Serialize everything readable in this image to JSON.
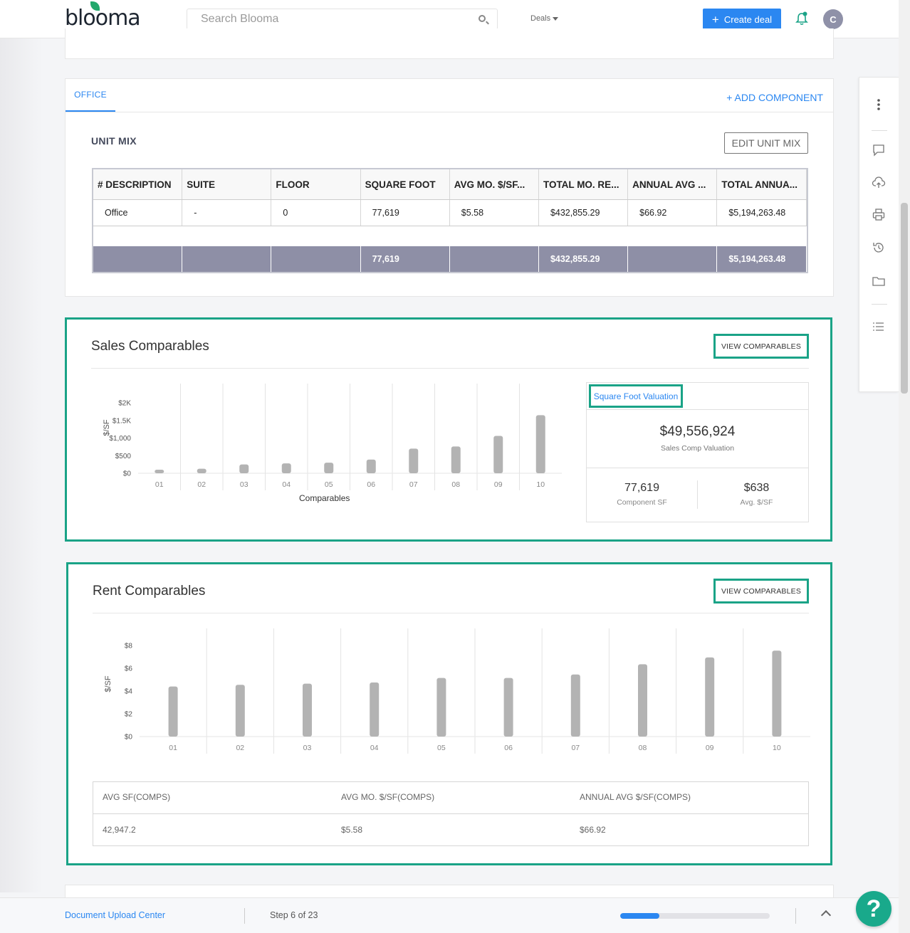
{
  "header": {
    "logo_text": "blooma",
    "search_placeholder": "Search Blooma",
    "deals_label": "Deals",
    "create_deal_label": "Create deal",
    "avatar_initial": "C"
  },
  "office_card": {
    "tab_label": "OFFICE",
    "add_component_label": "+ ADD COMPONENT",
    "unit_mix_title": "UNIT MIX",
    "edit_unit_mix_label": "EDIT UNIT MIX",
    "columns": [
      "# DESCRIPTION",
      "SUITE",
      "FLOOR",
      "SQUARE FOOT",
      "AVG MO. $/SF...",
      "TOTAL MO. RE...",
      "ANNUAL AVG ...",
      "TOTAL ANNUA..."
    ],
    "rows": [
      [
        "Office",
        "-",
        "0",
        "77,619",
        "$5.58",
        "$432,855.29",
        "$66.92",
        "$5,194,263.48"
      ]
    ],
    "totals": [
      "",
      "",
      "",
      "77,619",
      "",
      "$432,855.29",
      "",
      "$5,194,263.48"
    ]
  },
  "sales": {
    "title": "Sales Comparables",
    "view_label": "VIEW COMPARABLES",
    "valuation_tab": "Square Foot Valuation",
    "valuation_value": "$49,556,924",
    "valuation_label": "Sales Comp Valuation",
    "component_sf": "77,619",
    "component_sf_label": "Component SF",
    "avg_sf": "$638",
    "avg_sf_label": "Avg. $/SF"
  },
  "rent": {
    "title": "Rent Comparables",
    "view_label": "VIEW COMPARABLES",
    "table_headers": [
      "AVG SF(COMPS)",
      "AVG MO. $/SF(COMPS)",
      "ANNUAL AVG $/SF(COMPS)"
    ],
    "table_values": [
      "42,947.2",
      "$5.58",
      "$66.92"
    ]
  },
  "bottom_bar": {
    "doc_upload_label": "Document Upload Center",
    "step_label": "Step 6 of 23",
    "progress": 0.26
  },
  "help_label": "?",
  "colors": {
    "accent": "#2b87f1",
    "highlight": "#1aa387",
    "bar": "#b3b3b3",
    "total_row": "#8e8fa6"
  },
  "side_icons": [
    "more-vertical-icon",
    "comment-icon",
    "cloud-upload-icon",
    "print-icon",
    "history-icon",
    "folder-icon",
    "list-icon"
  ],
  "chart_data": [
    {
      "type": "bar",
      "categories": [
        "01",
        "02",
        "03",
        "04",
        "05",
        "06",
        "07",
        "08",
        "09",
        "10"
      ],
      "values": [
        100,
        130,
        250,
        280,
        300,
        390,
        700,
        760,
        1060,
        1650
      ],
      "xlabel": "Comparables",
      "ylabel": "$/SF",
      "ylim": [
        0,
        2000
      ],
      "yticks": [
        0,
        500,
        1000,
        1500,
        2000
      ],
      "ytick_labels": [
        "$0",
        "$500",
        "$1,000",
        "$1.5K",
        "$2K"
      ],
      "grid": "vertical"
    },
    {
      "type": "bar",
      "categories": [
        "01",
        "02",
        "03",
        "04",
        "05",
        "06",
        "07",
        "08",
        "09",
        "10"
      ],
      "values": [
        4.4,
        4.55,
        4.65,
        4.75,
        5.15,
        5.15,
        5.45,
        6.35,
        6.95,
        7.55
      ],
      "xlabel": "",
      "ylabel": "$/SF",
      "ylim": [
        0,
        8
      ],
      "yticks": [
        0,
        2,
        4,
        6,
        8
      ],
      "ytick_labels": [
        "$0",
        "$2",
        "$4",
        "$6",
        "$8"
      ],
      "grid": "vertical"
    }
  ]
}
